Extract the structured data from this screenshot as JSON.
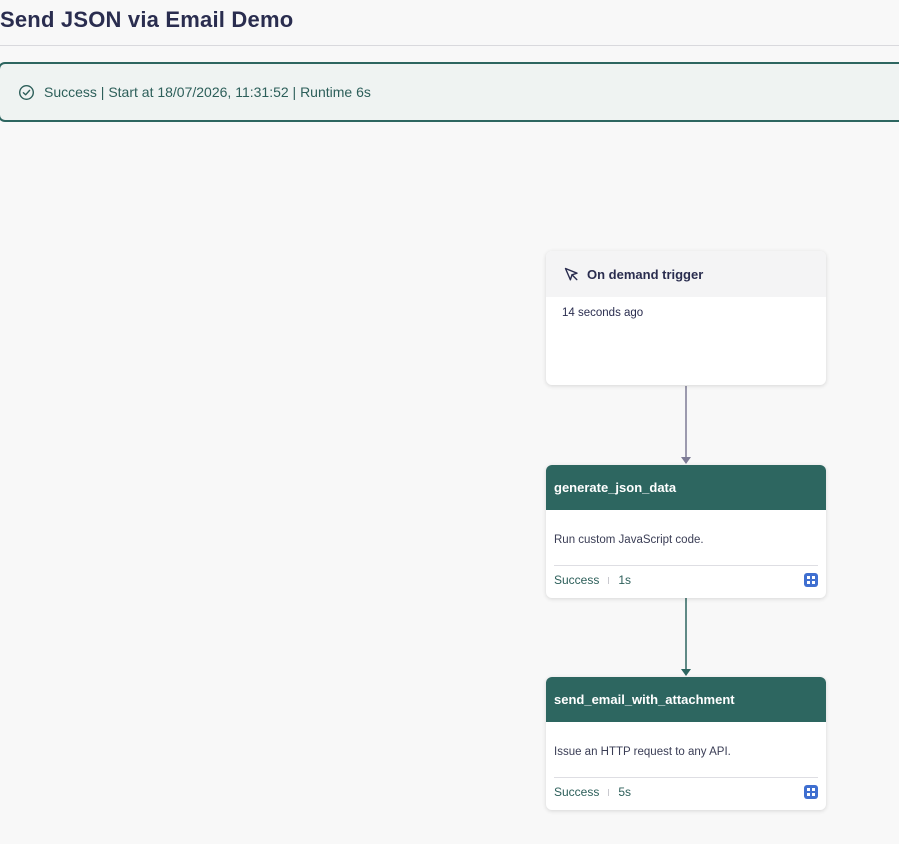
{
  "header": {
    "title": "Send JSON via Email Demo"
  },
  "status_banner": {
    "text": "Success | Start at 18/07/2026, 11:31:52 | Runtime 6s",
    "icon": "check-circle-icon",
    "color": "#2d6660"
  },
  "workflow": {
    "trigger": {
      "title": "On demand trigger",
      "icon": "cursor-icon",
      "time": "14 seconds ago"
    },
    "tasks": [
      {
        "title": "generate_json_data",
        "description": "Run custom JavaScript code.",
        "status": "Success",
        "duration": "1s",
        "icon": "details-icon"
      },
      {
        "title": "send_email_with_attachment",
        "description": "Issue an HTTP request to any API.",
        "status": "Success",
        "duration": "5s",
        "icon": "details-icon"
      }
    ]
  },
  "colors": {
    "accent": "#2d6660",
    "link_pending": "#7d7b95",
    "link_done": "#2d6660",
    "detail_icon": "#3f6fd0"
  }
}
